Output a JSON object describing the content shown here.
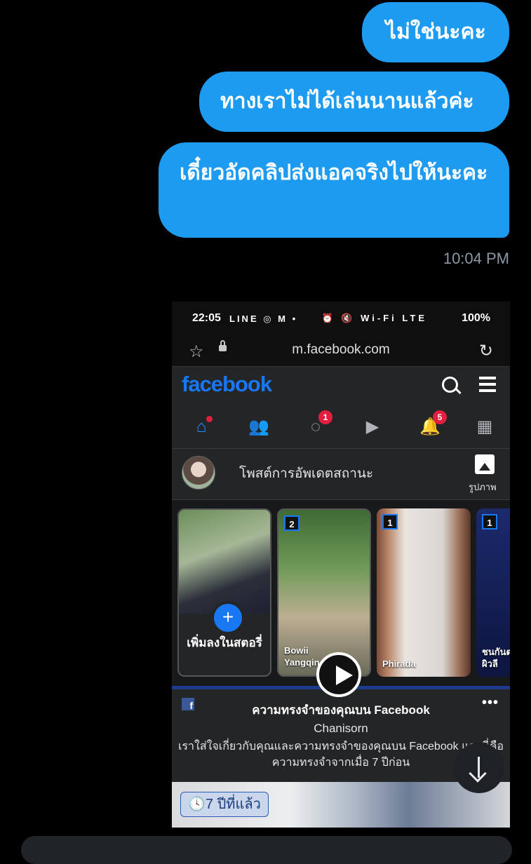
{
  "messages": [
    {
      "text": "ไม่ใช่นะคะ"
    },
    {
      "text": "ทางเราไม่ได้เล่นนานแล้วค่ะ"
    },
    {
      "text": "เดี๋ยวอัดคลิปส่งแอคจริงไปให้นะคะ"
    }
  ],
  "timestamp": "10:04 PM",
  "attachment": {
    "status_bar": {
      "time": "22:05",
      "left_icons": "LINE ◎ M •",
      "right_icons": "⏰ 🔇 Wi-Fi LTE",
      "battery": "100%"
    },
    "browser": {
      "url": "m.facebook.com",
      "star_icon": "☆",
      "reload_icon": "↻"
    },
    "facebook": {
      "logo": "facebook",
      "nav": [
        {
          "name": "home",
          "glyph": "⌂",
          "badge": ""
        },
        {
          "name": "friends",
          "glyph": "👥",
          "badge": ""
        },
        {
          "name": "messenger",
          "glyph": "◌",
          "badge": "1"
        },
        {
          "name": "watch",
          "glyph": "▶",
          "badge": ""
        },
        {
          "name": "notifications",
          "glyph": "🔔",
          "badge": "5"
        },
        {
          "name": "marketplace",
          "glyph": "▦",
          "badge": ""
        }
      ],
      "composer_placeholder": "โพสต์การอัพเดตสถานะ",
      "photo_label": "รูปภาพ",
      "stories": {
        "add_label": "เพิ่มลงในสตอรี่",
        "items": [
          {
            "count": "2",
            "name": "Bowii\nYangqin"
          },
          {
            "count": "1",
            "name": "Phirada"
          },
          {
            "count": "1",
            "name": "ชนกันต\nผิวลี"
          }
        ]
      },
      "memory": {
        "title": "ความทรงจำของคุณบน Facebook",
        "name": "Chanisorn",
        "description": "เราใส่ใจเกี่ยวกับคุณและความทรงจำของคุณบน Facebook และนี่คือความทรงจำจากเมื่อ 7 ปีก่อน",
        "more": "•••",
        "years_ago": "🕓7 ปีที่แล้ว"
      }
    }
  },
  "colors": {
    "bubble": "#1d9bf0",
    "background": "#000000",
    "timestamp": "#8b98a5",
    "fb_blue": "#1877f2"
  }
}
